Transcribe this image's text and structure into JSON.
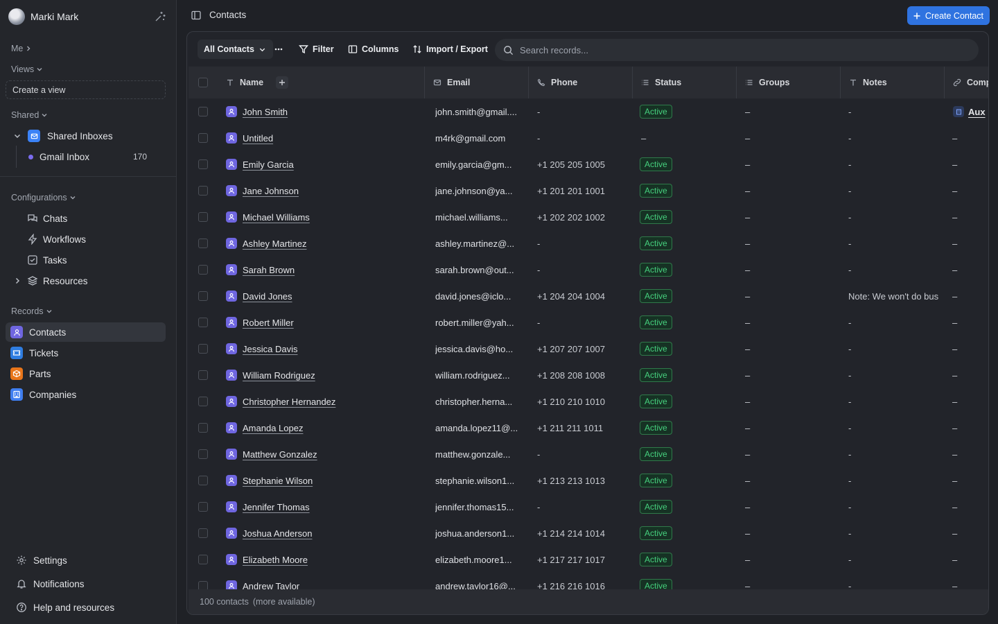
{
  "user": {
    "name": "Marki Mark"
  },
  "sidebar": {
    "me_label": "Me",
    "views_label": "Views",
    "create_view": "Create a view",
    "shared_label": "Shared",
    "shared_inboxes": "Shared Inboxes",
    "gmail_inbox": {
      "label": "Gmail Inbox",
      "count": "170"
    },
    "configurations_label": "Configurations",
    "config_items": [
      {
        "label": "Chats",
        "icon": "chat-icon"
      },
      {
        "label": "Workflows",
        "icon": "lightning-icon"
      },
      {
        "label": "Tasks",
        "icon": "checkbox-icon"
      },
      {
        "label": "Resources",
        "icon": "layers-icon"
      }
    ],
    "records_label": "Records",
    "record_items": [
      {
        "label": "Contacts",
        "icon": "person-icon",
        "color": "#6f66e0"
      },
      {
        "label": "Tickets",
        "icon": "ticket-icon",
        "color": "#2f7de1"
      },
      {
        "label": "Parts",
        "icon": "box-icon",
        "color": "#e8751a"
      },
      {
        "label": "Companies",
        "icon": "building-icon",
        "color": "#3f7ef0"
      }
    ],
    "bottom_items": [
      {
        "label": "Settings",
        "icon": "gear-icon"
      },
      {
        "label": "Notifications",
        "icon": "bell-icon"
      },
      {
        "label": "Help and resources",
        "icon": "help-icon"
      }
    ]
  },
  "header": {
    "title": "Contacts",
    "create_button": "Create Contact"
  },
  "toolbar": {
    "view_select": "All Contacts",
    "filter": "Filter",
    "columns": "Columns",
    "import_export": "Import / Export",
    "search_placeholder": "Search records..."
  },
  "table": {
    "columns": [
      "Name",
      "Email",
      "Phone",
      "Status",
      "Groups",
      "Notes",
      "Comp"
    ],
    "rows": [
      {
        "name": "John Smith",
        "email": "john.smith@gmail....",
        "phone": "-",
        "status": "Active",
        "groups": "–",
        "notes": "-",
        "company": "Aux"
      },
      {
        "name": "Untitled",
        "email": "m4rk@gmail.com",
        "phone": "-",
        "status": "",
        "groups": "–",
        "notes": "-",
        "company": "–"
      },
      {
        "name": "Emily Garcia",
        "email": "emily.garcia@gm...",
        "phone": "+1 205 205 1005",
        "status": "Active",
        "groups": "–",
        "notes": "-",
        "company": "–"
      },
      {
        "name": "Jane Johnson",
        "email": "jane.johnson@ya...",
        "phone": "+1 201 201 1001",
        "status": "Active",
        "groups": "–",
        "notes": "-",
        "company": "–"
      },
      {
        "name": "Michael Williams",
        "email": "michael.williams...",
        "phone": "+1 202 202 1002",
        "status": "Active",
        "groups": "–",
        "notes": "-",
        "company": "–"
      },
      {
        "name": "Ashley Martinez",
        "email": "ashley.martinez@...",
        "phone": "-",
        "status": "Active",
        "groups": "–",
        "notes": "-",
        "company": "–"
      },
      {
        "name": "Sarah Brown",
        "email": "sarah.brown@out...",
        "phone": "-",
        "status": "Active",
        "groups": "–",
        "notes": "-",
        "company": "–"
      },
      {
        "name": "David Jones",
        "email": "david.jones@iclo...",
        "phone": "+1 204 204 1004",
        "status": "Active",
        "groups": "–",
        "notes": "Note: We won't do bus",
        "company": "–"
      },
      {
        "name": "Robert Miller",
        "email": "robert.miller@yah...",
        "phone": "-",
        "status": "Active",
        "groups": "–",
        "notes": "-",
        "company": "–"
      },
      {
        "name": "Jessica Davis",
        "email": "jessica.davis@ho...",
        "phone": "+1 207 207 1007",
        "status": "Active",
        "groups": "–",
        "notes": "-",
        "company": "–"
      },
      {
        "name": "William Rodriguez",
        "email": "william.rodriguez...",
        "phone": "+1 208 208 1008",
        "status": "Active",
        "groups": "–",
        "notes": "-",
        "company": "–"
      },
      {
        "name": "Christopher Hernandez",
        "email": "christopher.herna...",
        "phone": "+1 210 210 1010",
        "status": "Active",
        "groups": "–",
        "notes": "-",
        "company": "–"
      },
      {
        "name": "Amanda Lopez",
        "email": "amanda.lopez11@...",
        "phone": "+1 211 211 1011",
        "status": "Active",
        "groups": "–",
        "notes": "-",
        "company": "–"
      },
      {
        "name": "Matthew Gonzalez",
        "email": "matthew.gonzale...",
        "phone": "-",
        "status": "Active",
        "groups": "–",
        "notes": "-",
        "company": "–"
      },
      {
        "name": "Stephanie Wilson",
        "email": "stephanie.wilson1...",
        "phone": "+1 213 213 1013",
        "status": "Active",
        "groups": "–",
        "notes": "-",
        "company": "–"
      },
      {
        "name": "Jennifer Thomas",
        "email": "jennifer.thomas15...",
        "phone": "-",
        "status": "Active",
        "groups": "–",
        "notes": "-",
        "company": "–"
      },
      {
        "name": "Joshua Anderson",
        "email": "joshua.anderson1...",
        "phone": "+1 214 214 1014",
        "status": "Active",
        "groups": "–",
        "notes": "-",
        "company": "–"
      },
      {
        "name": "Elizabeth Moore",
        "email": "elizabeth.moore1...",
        "phone": "+1 217 217 1017",
        "status": "Active",
        "groups": "–",
        "notes": "-",
        "company": "–"
      },
      {
        "name": "Andrew Taylor",
        "email": "andrew.taylor16@...",
        "phone": "+1 216 216 1016",
        "status": "Active",
        "groups": "–",
        "notes": "-",
        "company": "–"
      }
    ]
  },
  "footer": {
    "count": "100 contacts",
    "more": "(more available)"
  },
  "colors": {
    "accent": "#2f73e0",
    "active_badge": "#46d07e",
    "contact_tile": "#6f66e0"
  }
}
